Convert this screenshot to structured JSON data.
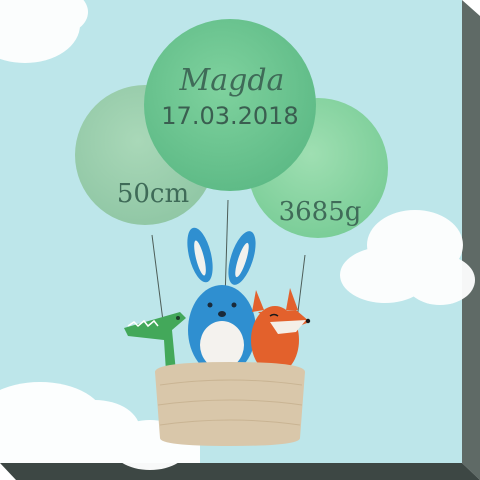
{
  "poster": {
    "name": "Magda",
    "date": "17.03.2018",
    "length": "50cm",
    "weight": "3685g"
  },
  "colors": {
    "sky": "#bde6ea",
    "balloon_left": "#9ccfae",
    "balloon_center": "#6fc991",
    "balloon_right": "#8fd7a6",
    "basket": "#d9c7aa",
    "rabbit": "#2f8fd0",
    "fox": "#e3612c",
    "crocodile": "#43a85a",
    "canvas_edge_right": "#5f6a66",
    "canvas_edge_bottom": "#3d4744"
  },
  "icons": [
    "balloon",
    "rabbit",
    "fox",
    "crocodile",
    "basket",
    "cloud"
  ]
}
